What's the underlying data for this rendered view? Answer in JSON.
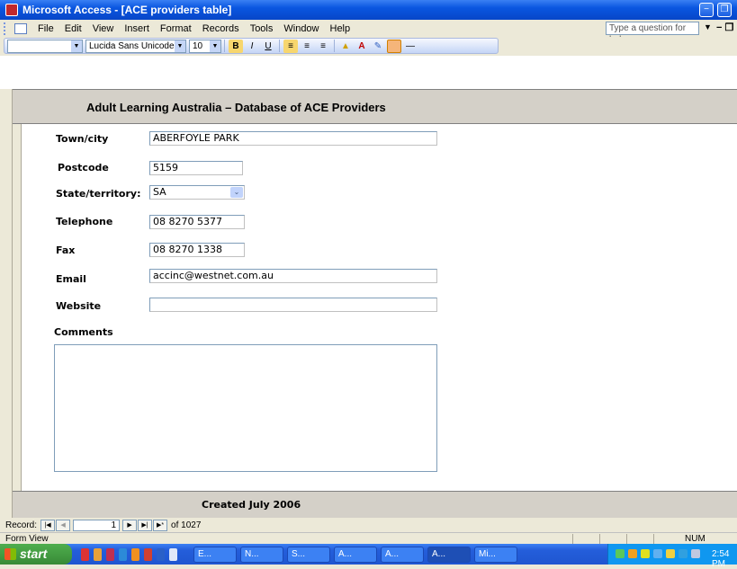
{
  "window": {
    "title": "Microsoft Access - [ACE providers table]"
  },
  "menubar": {
    "items": [
      "File",
      "Edit",
      "View",
      "Insert",
      "Format",
      "Records",
      "Tools",
      "Window",
      "Help"
    ],
    "help_placeholder": "Type a question for help"
  },
  "formatting_toolbar": {
    "font": "Lucida Sans Unicode",
    "size": "10"
  },
  "form": {
    "header_title": "Adult Learning Australia – Database of ACE Providers",
    "town_label": "Town/city",
    "town_value": "ABERFOYLE PARK",
    "postcode_label": "Postcode",
    "postcode_value": "5159",
    "state_label": "State/territory:",
    "state_value": "SA",
    "telephone_label": "Telephone",
    "telephone_value": "08 8270 5377",
    "fax_label": "Fax",
    "fax_value": "08 8270 1338",
    "email_label": "Email",
    "email_value": "accinc@westnet.com.au",
    "website_label": "Website",
    "website_value": "",
    "comments_label": "Comments",
    "footer_text": "Created July 2006"
  },
  "navigation": {
    "record_label": "Record:",
    "current_record": "1",
    "of_text": "of 1027"
  },
  "statusbar": {
    "view": "Form View",
    "num": "NUM"
  },
  "taskbar": {
    "start_label": "start",
    "tasks": [
      "E...",
      "N...",
      "S...",
      "A...",
      "A...",
      "A...",
      "Mi..."
    ],
    "clock": "2:54 PM"
  }
}
